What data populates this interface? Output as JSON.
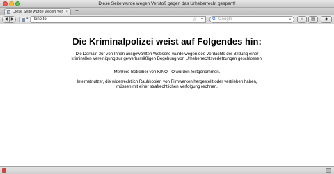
{
  "window": {
    "title": "Diese Seite wurde wegen Verstoß gegen das Urheberrecht gesperrt!"
  },
  "tabs": [
    {
      "label": "Diese Seite wurde wegen Versto...",
      "close": "×"
    }
  ],
  "new_tab": "+",
  "navigation": {
    "back": "◀",
    "forward": "▶",
    "url": "kino.to",
    "bookmark_star": "☆",
    "dropdown": "▾",
    "search": {
      "logo": "G",
      "placeholder": "Google",
      "go": "⌕"
    },
    "home": "⌂",
    "bookmarks": "▤",
    "extra": "◆"
  },
  "content": {
    "heading": "Die Kriminalpolizei weist auf Folgendes hin:",
    "paragraph_1": "Die Domain zur von Ihnen ausgewählten Webseite wurde wegen des Verdachts der Bildung einer kriminellen Vereinigung zur gewerbsmäßigen Begehung von Urheberrechtsverletzungen geschlossen.",
    "paragraph_2": "Mehrere Betreiber von KINO.TO wurden festgenommen.",
    "paragraph_3": "Internetnutzer, die widerrechtlich Raubkopien von Filmwerken hergestellt oder vertrieben haben, müssen mit einer strafrechtlichen Verfolgung rechnen."
  }
}
